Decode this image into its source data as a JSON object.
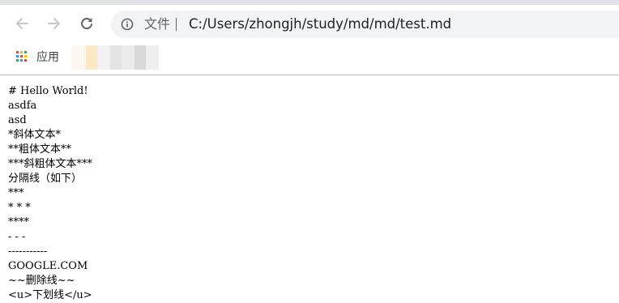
{
  "browser": {
    "url_scheme_label": "文件",
    "url": "C:/Users/zhongjh/study/md/md/test.md",
    "icons": {
      "back": "arrow-left-icon",
      "forward": "arrow-right-icon",
      "reload": "reload-icon",
      "info": "info-icon",
      "apps": "apps-grid-icon"
    }
  },
  "bookmarks": {
    "apps_label": "应用"
  },
  "document": {
    "lines": [
      "# Hello World!",
      "asdfa",
      "asd",
      "*斜体文本*",
      "**粗体文本**",
      "***斜粗体文本***",
      "分隔线（如下）",
      "***",
      "* * *",
      "****",
      "- - -",
      "-----------",
      "GOOGLE.COM",
      "~~删除线~~",
      "<u>下划线</u>"
    ]
  },
  "colors": {
    "icon_gray": "#5f6368",
    "omnibox_bg": "#f1f3f4",
    "apps_red": "#ea4335",
    "apps_yellow": "#fbbc04",
    "apps_green": "#34a853",
    "apps_blue": "#4285f4"
  }
}
